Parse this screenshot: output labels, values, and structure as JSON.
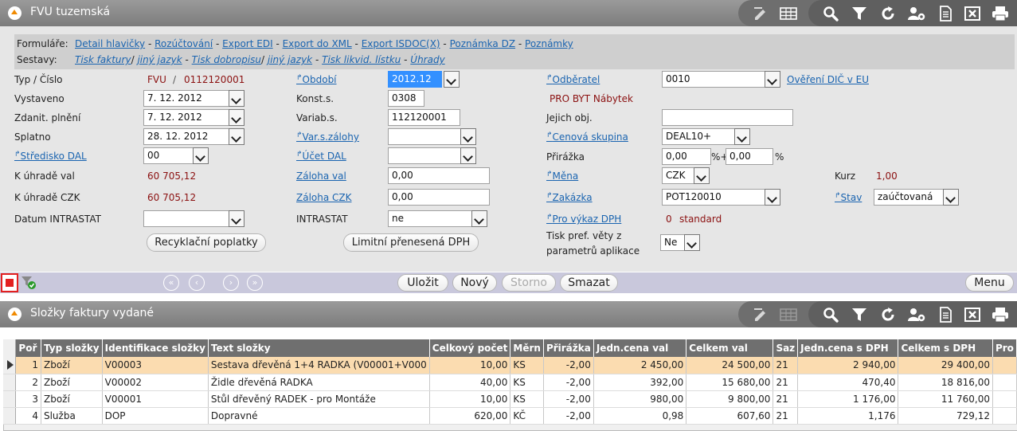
{
  "header": {
    "title": "FVU tuzemská"
  },
  "nav": {
    "forms_label": "Formuláře:",
    "forms": [
      "Detail hlavičky",
      "Rozúčtování",
      "Export EDI",
      "Export do XML",
      "Export ISDOC(X)",
      "Poznámka DZ",
      "Poznámky"
    ],
    "reports_label": "Sestavy:",
    "reports": [
      {
        "text": "Tisk faktury",
        "sep": "/"
      },
      {
        "text": "jiný jazyk",
        "sep": "-"
      },
      {
        "text": "Tisk dobropisu",
        "sep": "/"
      },
      {
        "text": "jiný jazyk",
        "sep": "-"
      },
      {
        "text": "Tisk likvid. lístku",
        "sep": "-"
      },
      {
        "text": "Úhrady",
        "sep": ""
      }
    ]
  },
  "form": {
    "typ_cislo_label": "Typ / Číslo",
    "typ": "FVU",
    "slash": "/",
    "cislo": "0112120001",
    "vystaveno_label": "Vystaveno",
    "vystaveno": "7. 12. 2012",
    "zdanit_label": "Zdanit. plnění",
    "zdanit": "7. 12. 2012",
    "splatno_label": "Splatno",
    "splatno": "28. 12. 2012",
    "stredisko_label": "Středisko DAL",
    "stredisko": "00",
    "kuhrade_val_label": "K úhradě val",
    "kuhrade_val": "60 705,12",
    "kuhrade_czk_label": "K úhradě CZK",
    "kuhrade_czk": "60 705,12",
    "datum_intrastat_label": "Datum INTRASTAT",
    "datum_intrastat": "",
    "recyklacni_btn": "Recyklační poplatky",
    "obdobi_label": "Období",
    "obdobi": "2012.12",
    "konst_label": "Konst.s.",
    "konst": "0308",
    "variab_label": "Variab.s.",
    "variab": "112120001",
    "var_zalohy_label": "Var.s.zálohy",
    "var_zalohy": "",
    "ucet_label": "Účet DAL",
    "ucet": "",
    "zaloha_val_label": "Záloha val",
    "zaloha_val": "0,00",
    "zaloha_czk_label": "Záloha CZK",
    "zaloha_czk": "0,00",
    "intrastat_label": "INTRASTAT",
    "intrastat": "ne",
    "limitni_btn": "Limitní přenesená DPH",
    "odberatel_label": "Odběratel",
    "odberatel": "0010",
    "overeni_link": "Ověření DIČ v EU",
    "odberatel_name": "PRO BYT Nábytek",
    "jejich_label": "Jejich obj.",
    "jejich": "",
    "cenova_label": "Cenová skupina",
    "cenova": "DEAL10+",
    "prirazka_label": "Přirážka",
    "prirazka1": "0,00",
    "prirazka_plus": "%+",
    "prirazka2": "0,00",
    "prirazka_pct": "%",
    "mena_label": "Měna",
    "mena": "CZK",
    "kurz_label": "Kurz",
    "kurz": "1,00",
    "zakazka_label": "Zakázka",
    "zakazka": "POT120010",
    "stav_label": "Stav",
    "stav": "zaúčtovaná",
    "vykaz_label": "Pro výkaz DPH",
    "vykaz_num": "0",
    "vykaz_text": "standard",
    "tisk_pref_line1": "Tisk pref. věty z",
    "tisk_pref_line2": "parametrů aplikace",
    "tisk_pref": "Ne"
  },
  "actions": {
    "save": "Uložit",
    "new": "Nový",
    "storno": "Storno",
    "delete": "Smazat",
    "menu": "Menu"
  },
  "grid": {
    "title": "Složky faktury vydané",
    "columns": [
      "Poř",
      "Typ složky",
      "Identifikace složky",
      "Text složky",
      "Celkový počet",
      "Měrn",
      "Přirážka",
      "Jedn.cena val",
      "Celkem val",
      "Saz",
      "Jedn.cena s DPH",
      "Celkem s DPH",
      "Pro"
    ],
    "rows": [
      {
        "por": "1",
        "typ": "Zboží",
        "id": "V00003",
        "text": "Sestava dřevěná 1+4 RADKA (V00001+V000",
        "pocet": "10,00",
        "mj": "KS",
        "prirazka": "-2,00",
        "jc": "2 450,00",
        "celkem": "24 500,00",
        "saz": "21",
        "jc_dph": "2 940,00",
        "celkem_dph": "29 400,00",
        "pro": ""
      },
      {
        "por": "2",
        "typ": "Zboží",
        "id": "V00002",
        "text": "Židle dřevěná RADKA",
        "pocet": "40,00",
        "mj": "KS",
        "prirazka": "-2,00",
        "jc": "392,00",
        "celkem": "15 680,00",
        "saz": "21",
        "jc_dph": "470,40",
        "celkem_dph": "18 816,00",
        "pro": ""
      },
      {
        "por": "3",
        "typ": "Zboží",
        "id": "V00001",
        "text": "Stůl dřevěný RADEK - pro Montáže",
        "pocet": "10,00",
        "mj": "KS",
        "prirazka": "-2,00",
        "jc": "980,00",
        "celkem": "9 800,00",
        "saz": "21",
        "jc_dph": "1 176,00",
        "celkem_dph": "11 760,00",
        "pro": ""
      },
      {
        "por": "4",
        "typ": "Služba",
        "id": "DOP",
        "text": "Dopravné",
        "pocet": "620,00",
        "mj": "KČ",
        "prirazka": "-2,00",
        "jc": "0,98",
        "celkem": "607,60",
        "saz": "21",
        "jc_dph": "1,176",
        "celkem_dph": "729,12",
        "pro": ""
      }
    ]
  }
}
